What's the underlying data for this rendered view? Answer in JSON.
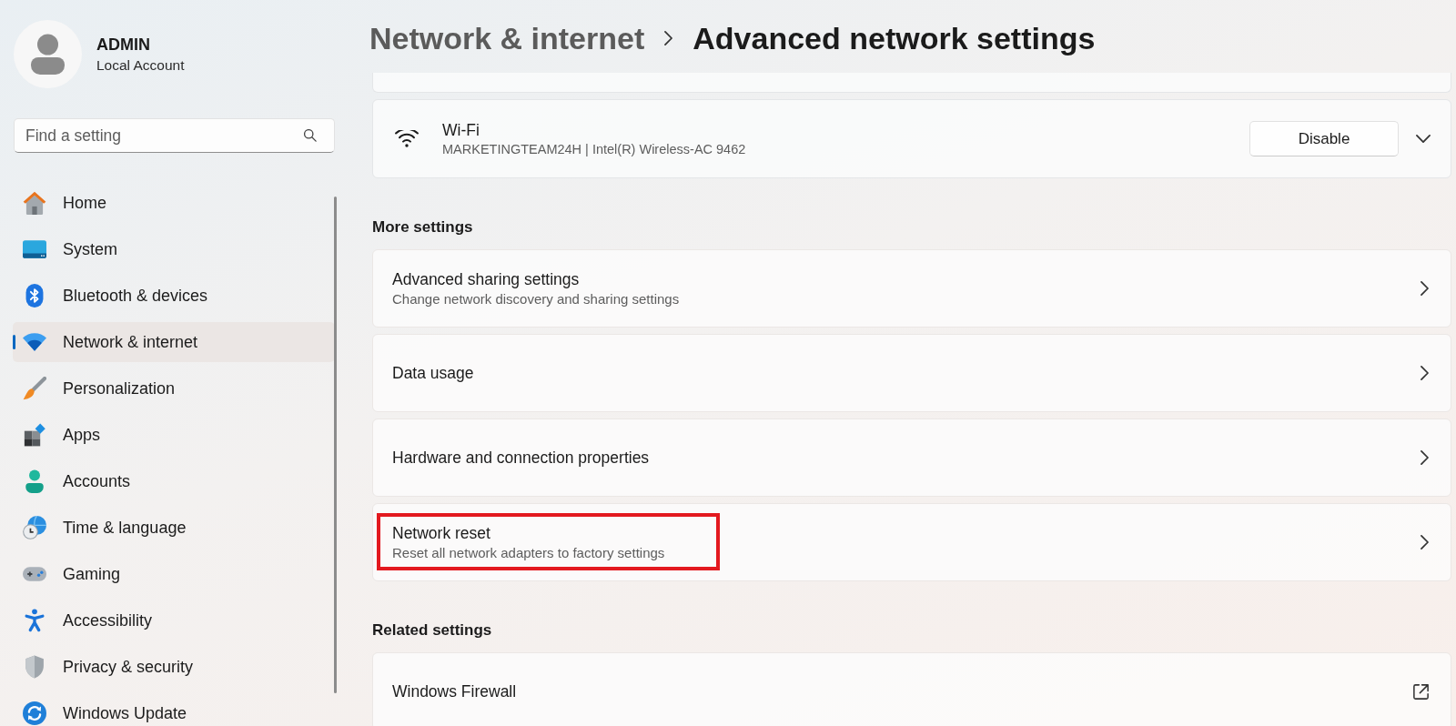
{
  "account": {
    "name": "ADMIN",
    "type": "Local Account"
  },
  "search": {
    "placeholder": "Find a setting"
  },
  "nav": [
    {
      "label": "Home",
      "selected": false
    },
    {
      "label": "System",
      "selected": false
    },
    {
      "label": "Bluetooth & devices",
      "selected": false
    },
    {
      "label": "Network & internet",
      "selected": true
    },
    {
      "label": "Personalization",
      "selected": false
    },
    {
      "label": "Apps",
      "selected": false
    },
    {
      "label": "Accounts",
      "selected": false
    },
    {
      "label": "Time & language",
      "selected": false
    },
    {
      "label": "Gaming",
      "selected": false
    },
    {
      "label": "Accessibility",
      "selected": false
    },
    {
      "label": "Privacy & security",
      "selected": false
    },
    {
      "label": "Windows Update",
      "selected": false
    }
  ],
  "breadcrumb": {
    "parent": "Network & internet",
    "current": "Advanced network settings"
  },
  "adapter": {
    "name": "Wi-Fi",
    "details": "MARKETINGTEAM24H | Intel(R) Wireless-AC 9462",
    "button": "Disable",
    "expanded": false
  },
  "sections": [
    {
      "heading": "More settings",
      "items": [
        {
          "kind": "page",
          "title": "Advanced sharing settings",
          "subtitle": "Change network discovery and sharing settings",
          "highlighted": false
        },
        {
          "kind": "page",
          "title": "Data usage",
          "highlighted": false
        },
        {
          "kind": "page",
          "title": "Hardware and connection properties",
          "highlighted": false
        },
        {
          "kind": "page",
          "title": "Network reset",
          "subtitle": "Reset all network adapters to factory settings",
          "highlighted": true
        }
      ]
    },
    {
      "heading": "Related settings",
      "items": [
        {
          "kind": "external",
          "title": "Windows Firewall",
          "highlighted": false
        }
      ]
    }
  ]
}
